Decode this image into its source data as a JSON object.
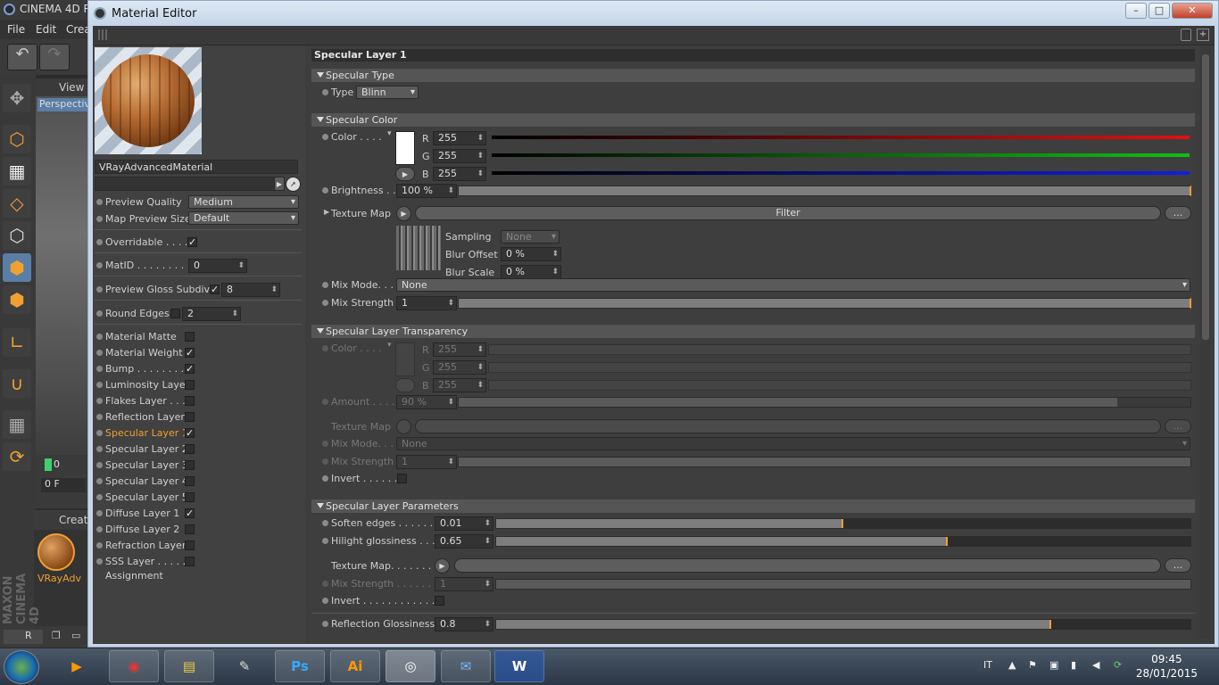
{
  "app": {
    "title": "CINEMA 4D R",
    "menu": [
      "File",
      "Edit",
      "Crea"
    ],
    "viewport_label": "View",
    "viewport_mode": "Perspectiv",
    "frame": "0 F",
    "frame_start": "0",
    "mat_tab": "Creat",
    "material_label": "VRayAdv",
    "maxon": "MAXON CINEMA 4D",
    "bottom_tab": "R"
  },
  "window": {
    "title": "Material Editor"
  },
  "left": {
    "material_name": "VRayAdvancedMaterial",
    "preview_quality": {
      "label": "Preview Quality",
      "value": "Medium"
    },
    "map_preview_size": {
      "label": "Map Preview Size",
      "value": "Default"
    },
    "overridable": {
      "label": "Overridable . . . .",
      "checked": true
    },
    "matid": {
      "label": "MatID . . . . . . . . .",
      "value": "0"
    },
    "gloss_subdivs": {
      "label": "Preview Gloss Subdivs",
      "value": "8"
    },
    "round_edges": {
      "label": "Round Edges",
      "value": "2"
    },
    "layers": [
      {
        "label": "Material Matte",
        "checked": false,
        "active": false
      },
      {
        "label": "Material Weight",
        "checked": true,
        "active": false
      },
      {
        "label": "Bump . . . . . . . . .",
        "checked": true,
        "active": false
      },
      {
        "label": "Luminosity Layer",
        "checked": false,
        "active": false
      },
      {
        "label": "Flakes Layer . . . .",
        "checked": false,
        "active": false
      },
      {
        "label": "Reflection Layer",
        "checked": false,
        "active": false
      },
      {
        "label": "Specular Layer 1",
        "checked": true,
        "active": true
      },
      {
        "label": "Specular Layer 2",
        "checked": false,
        "active": false
      },
      {
        "label": "Specular Layer 3",
        "checked": false,
        "active": false
      },
      {
        "label": "Specular Layer 4",
        "checked": false,
        "active": false
      },
      {
        "label": "Specular Layer 5",
        "checked": false,
        "active": false
      },
      {
        "label": "Diffuse Layer 1",
        "checked": true,
        "active": false
      },
      {
        "label": "Diffuse Layer 2",
        "checked": false,
        "active": false
      },
      {
        "label": "Refraction Layer",
        "checked": false,
        "active": false
      },
      {
        "label": "SSS Layer . . . . . .",
        "checked": false,
        "active": false
      }
    ],
    "assignment": "Assignment"
  },
  "right": {
    "panel_title": "Specular Layer 1",
    "specular_type": {
      "header": "Specular Type",
      "label": "Type",
      "value": "Blinn"
    },
    "specular_color": {
      "header": "Specular Color",
      "color_label": "Color . . . .",
      "r_label": "R",
      "r": "255",
      "g_label": "G",
      "g": "255",
      "b_label": "B",
      "b": "255",
      "brightness_label": "Brightness . .",
      "brightness": "100 %",
      "brightness_level": 1.0,
      "texture_map_label": "Texture Map",
      "filter": "Filter",
      "more": "...",
      "sampling_label": "Sampling",
      "sampling": "None",
      "blur_offset_label": "Blur Offset",
      "blur_offset": "0 %",
      "blur_scale_label": "Blur Scale",
      "blur_scale": "0 %",
      "mix_mode_label": "Mix Mode. . .",
      "mix_mode": "None",
      "mix_strength_label": "Mix Strength",
      "mix_strength": "1",
      "mix_strength_level": 1.0
    },
    "transparency": {
      "header": "Specular Layer Transparency",
      "color_label": "Color . . . .",
      "r_label": "R",
      "r": "255",
      "g_label": "G",
      "g": "255",
      "b_label": "B",
      "b": "255",
      "amount_label": "Amount . . . .",
      "amount": "90 %",
      "amount_level": 0.9,
      "texture_map_label": "Texture Map",
      "more": "...",
      "mix_mode_label": "Mix Mode. . .",
      "mix_mode": "None",
      "mix_strength_label": "Mix Strength",
      "mix_strength": "1",
      "invert_label": "Invert . . . . . ."
    },
    "parameters": {
      "header": "Specular Layer Parameters",
      "soften_label": "Soften edges . . . . . . .",
      "soften": "0.01",
      "soften_level": 0.5,
      "hilight_label": "Hilight glossiness . . .",
      "hilight": "0.65",
      "hilight_level": 0.65,
      "texture_map_label": "Texture Map. . . . . . . .",
      "more": "...",
      "mix_strength_label": "Mix Strength . . . . . . .",
      "mix_strength": "1",
      "invert_label": "Invert . . . . . . . . . . . . .",
      "refl_gloss_label": "Reflection Glossiness",
      "refl_gloss": "0.8",
      "refl_gloss_level": 0.8
    }
  },
  "taskbar": {
    "lang": "IT",
    "time": "09:45",
    "date": "28/01/2015",
    "apps": [
      "Ps",
      "Ai",
      "W"
    ]
  },
  "colors": {
    "accent": "#f0a030",
    "red": "#e01010",
    "green": "#10c010",
    "blue": "#1020e0"
  }
}
